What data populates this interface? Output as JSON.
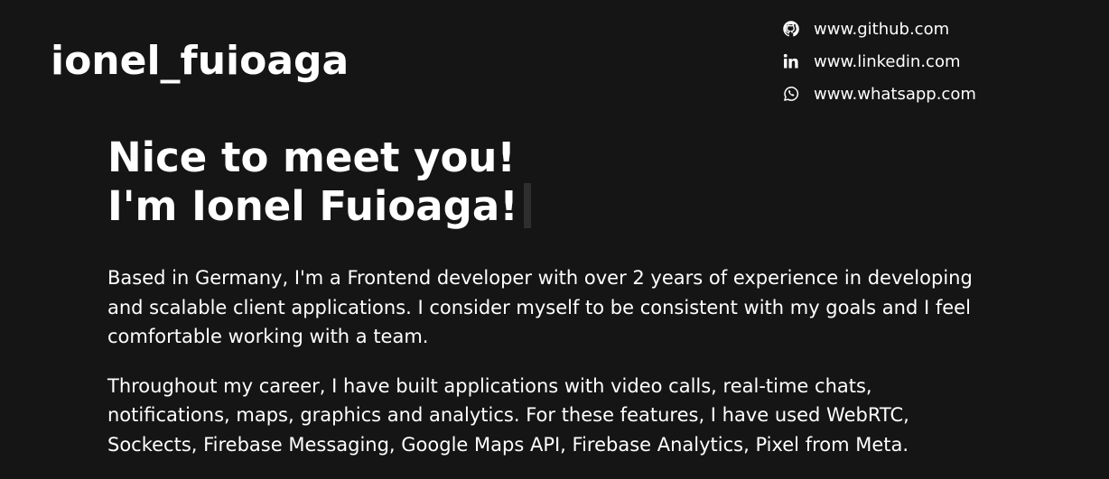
{
  "header": {
    "logo_text": "ionel_fuioaga"
  },
  "socials": [
    {
      "icon": "github-icon",
      "label": "www.github.com"
    },
    {
      "icon": "linkedin-icon",
      "label": "www.linkedin.com"
    },
    {
      "icon": "whatsapp-icon",
      "label": "www.whatsapp.com"
    }
  ],
  "hero": {
    "greeting": "Nice to meet you!",
    "intro": "I'm Ionel Fuioaga!"
  },
  "bio": {
    "paragraph_1": "Based in Germany, I'm a Frontend developer with over 2 years of experience in developing and scalable client applications. I consider myself to be consistent with my goals and I feel comfortable working with a team.",
    "paragraph_2": "Throughout my career, I have built applications with video calls, real-time chats, notifications, maps, graphics and analytics. For these features, I have used WebRTC, Sockects, Firebase Messaging, Google Maps API, Firebase Analytics, Pixel from Meta."
  },
  "colors": {
    "background": "#151515",
    "text": "#ffffff",
    "cursor": "#2e2e2e"
  }
}
